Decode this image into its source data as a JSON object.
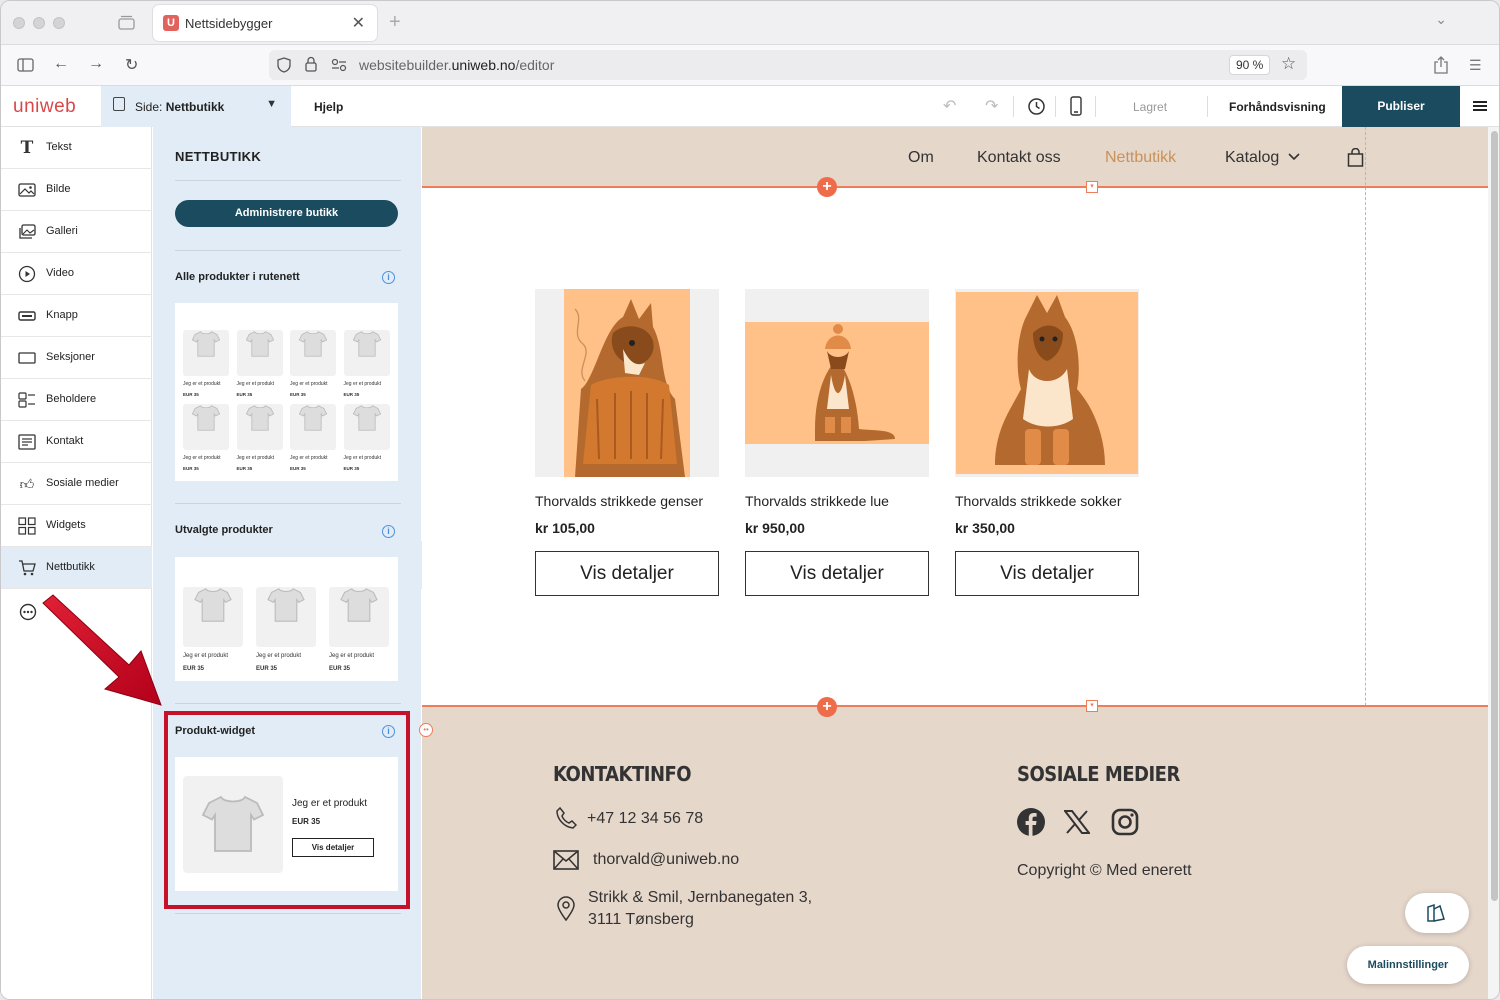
{
  "browser": {
    "tab_title": "Nettsidebygger",
    "tab_favicon_letter": "U",
    "url_prefix": "websitebuilder.",
    "url_domain": "uniweb.no",
    "url_path": "/editor",
    "zoom": "90 %"
  },
  "toolbar": {
    "logo": "uniweb",
    "page_prefix": "Side: ",
    "page_name": "Nettbutikk",
    "help": "Hjelp",
    "saved": "Lagret",
    "preview": "Forhåndsvisning",
    "publish": "Publiser"
  },
  "sidebar": {
    "items": [
      {
        "label": "Tekst",
        "icon": "text-icon"
      },
      {
        "label": "Bilde",
        "icon": "image-icon"
      },
      {
        "label": "Galleri",
        "icon": "gallery-icon"
      },
      {
        "label": "Video",
        "icon": "video-icon"
      },
      {
        "label": "Knapp",
        "icon": "button-icon"
      },
      {
        "label": "Seksjoner",
        "icon": "sections-icon"
      },
      {
        "label": "Beholdere",
        "icon": "containers-icon"
      },
      {
        "label": "Kontakt",
        "icon": "contact-icon"
      },
      {
        "label": "Sosiale medier",
        "icon": "thumbs-up-icon"
      },
      {
        "label": "Widgets",
        "icon": "widgets-icon"
      },
      {
        "label": "Nettbutikk",
        "icon": "cart-icon"
      }
    ],
    "active": "Nettbutikk"
  },
  "panel": {
    "title": "NETTBUTIKK",
    "admin_button": "Administrere butikk",
    "sections": [
      {
        "title": "Alle produkter i rutenett"
      },
      {
        "title": "Utvalgte produkter"
      },
      {
        "title": "Produkt-widget"
      }
    ],
    "placeholder_product": "Jeg er et produkt",
    "placeholder_price": "EUR 35",
    "placeholder_button": "Vis detaljer"
  },
  "site": {
    "nav": [
      {
        "label": "Om"
      },
      {
        "label": "Kontakt oss"
      },
      {
        "label": "Nettbutikk"
      },
      {
        "label": "Katalog"
      }
    ],
    "active_nav": "Nettbutikk",
    "accent_color": "#c9915a",
    "products": [
      {
        "name": "Thorvalds strikkede genser",
        "price": "kr 105,00",
        "button": "Vis detaljer"
      },
      {
        "name": "Thorvalds strikkede lue",
        "price": "kr 950,00",
        "button": "Vis detaljer"
      },
      {
        "name": "Thorvalds strikkede sokker",
        "price": "kr 350,00",
        "button": "Vis detaljer"
      }
    ],
    "footer": {
      "contact_heading": "KONTAKTINFO",
      "phone": "+47 12 34 56 78",
      "email": "thorvald@uniweb.no",
      "address_line1": "Strikk & Smil, Jernbanegaten 3,",
      "address_line2": "3111 Tønsberg",
      "social_heading": "SOSIALE MEDIER",
      "copyright": "Copyright © Med enerett"
    }
  },
  "template_settings": "Malinnstillinger"
}
